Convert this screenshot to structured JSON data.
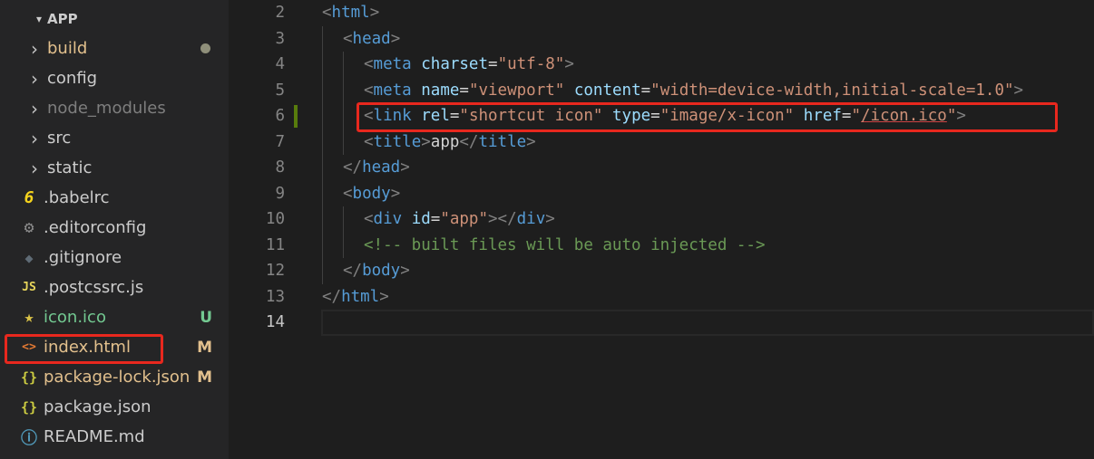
{
  "explorer": {
    "root_label": "APP",
    "items": [
      {
        "label": "build",
        "kind": "folder",
        "icon": "chevron-right-icon",
        "dim": false,
        "color": "#e2c08d",
        "dot": true
      },
      {
        "label": "config",
        "kind": "folder",
        "icon": "chevron-right-icon"
      },
      {
        "label": "node_modules",
        "kind": "folder",
        "icon": "chevron-right-icon",
        "dim": true
      },
      {
        "label": "src",
        "kind": "folder",
        "icon": "chevron-right-icon"
      },
      {
        "label": "static",
        "kind": "folder",
        "icon": "chevron-right-icon"
      },
      {
        "label": ".babelrc",
        "kind": "file",
        "icon": "babel-icon",
        "glyph": "6",
        "icon_color": "#f5d31d"
      },
      {
        "label": ".editorconfig",
        "kind": "file",
        "icon": "gear-icon",
        "glyph": "⚙",
        "icon_color": "#8e8e8e"
      },
      {
        "label": ".gitignore",
        "kind": "file",
        "icon": "git-icon",
        "glyph": "◆",
        "icon_color": "#5f6b75"
      },
      {
        "label": ".postcssrc.js",
        "kind": "file",
        "icon": "js-icon",
        "glyph": "JS",
        "icon_color": "#e6d45b"
      },
      {
        "label": "icon.ico",
        "kind": "file",
        "icon": "star-icon",
        "glyph": "★",
        "icon_color": "#d9c247",
        "color": "#73c991",
        "badge": "U",
        "badge_color": "#73c991"
      },
      {
        "label": "index.html",
        "kind": "file",
        "icon": "html-icon",
        "glyph": "<>",
        "icon_color": "#e37933",
        "color": "#e2c08d",
        "badge": "M",
        "badge_color": "#e2c08d"
      },
      {
        "label": "package-lock.json",
        "kind": "file",
        "icon": "json-icon",
        "glyph": "{}",
        "icon_color": "#cbcb41",
        "color": "#e2c08d",
        "badge": "M",
        "badge_color": "#e2c08d"
      },
      {
        "label": "package.json",
        "kind": "file",
        "icon": "json-icon",
        "glyph": "{}",
        "icon_color": "#cbcb41"
      },
      {
        "label": "README.md",
        "kind": "file",
        "icon": "info-icon",
        "glyph": "ⓘ",
        "icon_color": "#519aba"
      }
    ]
  },
  "editor": {
    "active_line": 14,
    "modified_line": 6,
    "lines": [
      {
        "n": "2",
        "indent": 0,
        "tokens": [
          [
            "t-punct",
            "<"
          ],
          [
            "t-tag",
            "html"
          ],
          [
            "t-punct",
            ">"
          ]
        ]
      },
      {
        "n": "3",
        "indent": 1,
        "tokens": [
          [
            "t-punct",
            "<"
          ],
          [
            "t-tag",
            "head"
          ],
          [
            "t-punct",
            ">"
          ]
        ]
      },
      {
        "n": "4",
        "indent": 2,
        "tokens": [
          [
            "t-punct",
            "<"
          ],
          [
            "t-tag",
            "meta"
          ],
          [
            "t-text",
            " "
          ],
          [
            "t-attr",
            "charset"
          ],
          [
            "t-text",
            "="
          ],
          [
            "t-str",
            "\"utf-8\""
          ],
          [
            "t-punct",
            ">"
          ]
        ]
      },
      {
        "n": "5",
        "indent": 2,
        "tokens": [
          [
            "t-punct",
            "<"
          ],
          [
            "t-tag",
            "meta"
          ],
          [
            "t-text",
            " "
          ],
          [
            "t-attr",
            "name"
          ],
          [
            "t-text",
            "="
          ],
          [
            "t-str",
            "\"viewport\""
          ],
          [
            "t-text",
            " "
          ],
          [
            "t-attr",
            "content"
          ],
          [
            "t-text",
            "="
          ],
          [
            "t-str",
            "\"width=device-width,initial-scale=1.0\""
          ],
          [
            "t-punct",
            ">"
          ]
        ]
      },
      {
        "n": "6",
        "indent": 2,
        "tokens": [
          [
            "t-punct",
            "<"
          ],
          [
            "t-tag",
            "link"
          ],
          [
            "t-text",
            " "
          ],
          [
            "t-attr",
            "rel"
          ],
          [
            "t-text",
            "="
          ],
          [
            "t-str",
            "\"shortcut icon\""
          ],
          [
            "t-text",
            " "
          ],
          [
            "t-attr",
            "type"
          ],
          [
            "t-text",
            "="
          ],
          [
            "t-str",
            "\"image/x-icon\""
          ],
          [
            "t-text",
            " "
          ],
          [
            "t-attr",
            "href"
          ],
          [
            "t-text",
            "="
          ],
          [
            "t-str",
            "\""
          ],
          [
            "t-str underline",
            "/icon.ico"
          ],
          [
            "t-str",
            "\""
          ],
          [
            "t-punct",
            ">"
          ]
        ]
      },
      {
        "n": "7",
        "indent": 2,
        "tokens": [
          [
            "t-punct",
            "<"
          ],
          [
            "t-tag",
            "title"
          ],
          [
            "t-punct",
            ">"
          ],
          [
            "t-text",
            "app"
          ],
          [
            "t-punct",
            "</"
          ],
          [
            "t-tag",
            "title"
          ],
          [
            "t-punct",
            ">"
          ]
        ]
      },
      {
        "n": "8",
        "indent": 1,
        "tokens": [
          [
            "t-punct",
            "</"
          ],
          [
            "t-tag",
            "head"
          ],
          [
            "t-punct",
            ">"
          ]
        ]
      },
      {
        "n": "9",
        "indent": 1,
        "tokens": [
          [
            "t-punct",
            "<"
          ],
          [
            "t-tag",
            "body"
          ],
          [
            "t-punct",
            ">"
          ]
        ]
      },
      {
        "n": "10",
        "indent": 2,
        "tokens": [
          [
            "t-punct",
            "<"
          ],
          [
            "t-tag",
            "div"
          ],
          [
            "t-text",
            " "
          ],
          [
            "t-attr",
            "id"
          ],
          [
            "t-text",
            "="
          ],
          [
            "t-str",
            "\"app\""
          ],
          [
            "t-punct",
            "></"
          ],
          [
            "t-tag",
            "div"
          ],
          [
            "t-punct",
            ">"
          ]
        ]
      },
      {
        "n": "11",
        "indent": 2,
        "tokens": [
          [
            "t-comment",
            "<!-- built files will be auto injected -->"
          ]
        ]
      },
      {
        "n": "12",
        "indent": 1,
        "tokens": [
          [
            "t-punct",
            "</"
          ],
          [
            "t-tag",
            "body"
          ],
          [
            "t-punct",
            ">"
          ]
        ]
      },
      {
        "n": "13",
        "indent": 0,
        "tokens": [
          [
            "t-punct",
            "</"
          ],
          [
            "t-tag",
            "html"
          ],
          [
            "t-punct",
            ">"
          ]
        ]
      },
      {
        "n": "14",
        "indent": 0,
        "tokens": []
      }
    ]
  },
  "colors": {
    "highlight": "#e8281e",
    "modified_gutter": "#587c0c"
  }
}
